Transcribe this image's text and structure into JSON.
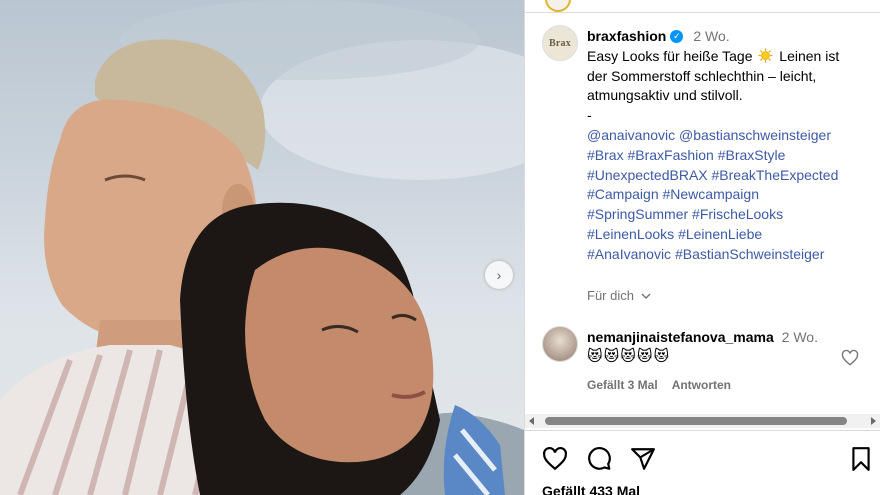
{
  "post": {
    "username": "braxfashion",
    "avatar_text": "Brax",
    "time": "2 Wo.",
    "caption_line1_a": "Easy Looks für heiße Tage",
    "caption_line1_b": "Leinen ist",
    "caption_line2": "der Sommerstoff schlechthin – leicht,",
    "caption_line3": "atmungsaktiv und stilvoll.",
    "caption_sep": "-",
    "mentions": "@anaivanovic @bastianschweinsteiger",
    "hashtag_lines": [
      "#Brax #BraxFashion #BraxStyle",
      "#UnexpectedBRAX #BreakTheExpected",
      "#Campaign #Newcampaign",
      "#SpringSummer #FrischeLooks",
      "#LeinenLooks #LeinenLiebe",
      "#AnaIvanovic #BastianSchweinsteiger"
    ],
    "translate_label": "Für dich"
  },
  "comment": {
    "username": "nemanjinaistefanova_mama",
    "time": "2 Wo.",
    "emojis": "😻😻😻😻😻",
    "likes_label": "Gefällt 3 Mal",
    "reply_label": "Antworten"
  },
  "footer": {
    "likes_text": "Gefällt 433 Mal"
  },
  "icons": {
    "verified": "verified-badge-icon",
    "sun": "sun-emoji-icon",
    "heart": "heart-icon",
    "comment": "comment-icon",
    "share": "share-icon",
    "save": "bookmark-icon",
    "next": "chevron-right-icon",
    "translate_chevron": "chevron-down-icon"
  },
  "colors": {
    "link": "#3d5aa5",
    "secondary": "#737373",
    "verified": "#0095f6"
  }
}
